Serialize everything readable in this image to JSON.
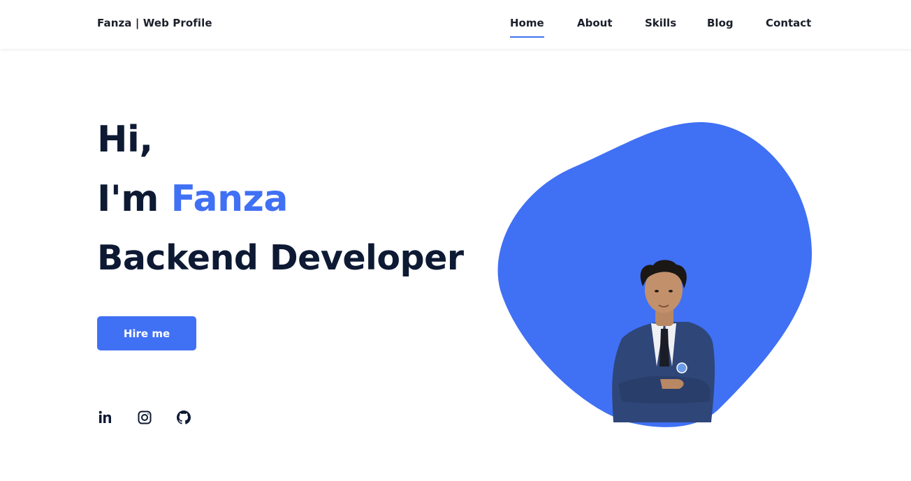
{
  "header": {
    "logo": "Fanza | Web Profile",
    "nav": [
      {
        "label": "Home",
        "active": true
      },
      {
        "label": "About",
        "active": false
      },
      {
        "label": "Skills",
        "active": false
      },
      {
        "label": "Blog",
        "active": false
      },
      {
        "label": "Contact",
        "active": false
      }
    ]
  },
  "hero": {
    "greeting": "Hi,",
    "intro_prefix": "I'm",
    "name": "Fanza",
    "role": "Backend Developer",
    "cta_label": "Hire me"
  },
  "social": [
    {
      "icon": "linkedin-icon"
    },
    {
      "icon": "instagram-icon"
    },
    {
      "icon": "github-icon"
    }
  ],
  "colors": {
    "accent": "#4070f4",
    "text_dark": "#0e1a33",
    "background": "#ffffff"
  }
}
